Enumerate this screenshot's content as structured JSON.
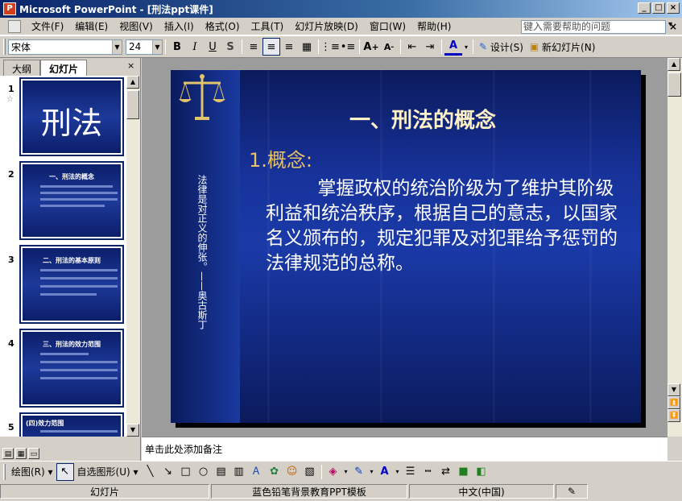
{
  "window": {
    "title": "Microsoft PowerPoint - [刑法ppt课件]"
  },
  "menu": {
    "items": [
      "文件(F)",
      "编辑(E)",
      "视图(V)",
      "插入(I)",
      "格式(O)",
      "工具(T)",
      "幻灯片放映(D)",
      "窗口(W)",
      "帮助(H)"
    ],
    "help_placeholder": "键入需要帮助的问题"
  },
  "toolbar": {
    "font": "宋体",
    "size": "24",
    "bold": "B",
    "italic": "I",
    "underline": "U",
    "shadow": "S",
    "design": "设计(S)",
    "new_slide": "新幻灯片(N)"
  },
  "leftpane": {
    "tabs": [
      "大纲",
      "幻灯片"
    ],
    "active_tab": "幻灯片",
    "slide_numbers": [
      "1",
      "2",
      "3",
      "4",
      "5"
    ],
    "thumbs": {
      "t1": "刑法",
      "t2": "一、刑法的概念",
      "t3": "二、刑法的基本原则",
      "t4": "三、刑法的效力范围",
      "t5": "(四)效力范围"
    }
  },
  "slide": {
    "title": "一、刑法的概念",
    "subtitle": "1.概念:",
    "body": "掌握政权的统治阶级为了维护其阶级利益和统治秩序，根据自己的意志，以国家名义颁布的，规定犯罪及对犯罪给予惩罚的法律规范的总称。",
    "vertical_quote": "法律是对正义的伸张。——奥古斯丁"
  },
  "notes": {
    "placeholder": "单击此处添加备注"
  },
  "drawbar": {
    "draw": "绘图(R)",
    "autoshapes": "自选图形(U)"
  },
  "status": {
    "view": "幻灯片",
    "template": "蓝色铅笔背景教育PPT模板",
    "language": "中文(中国)"
  },
  "colors": {
    "slide_bg": "#17329a",
    "title": "#fff1c6",
    "subtitle": "#e8c268",
    "titlebar": "#0a246a"
  }
}
